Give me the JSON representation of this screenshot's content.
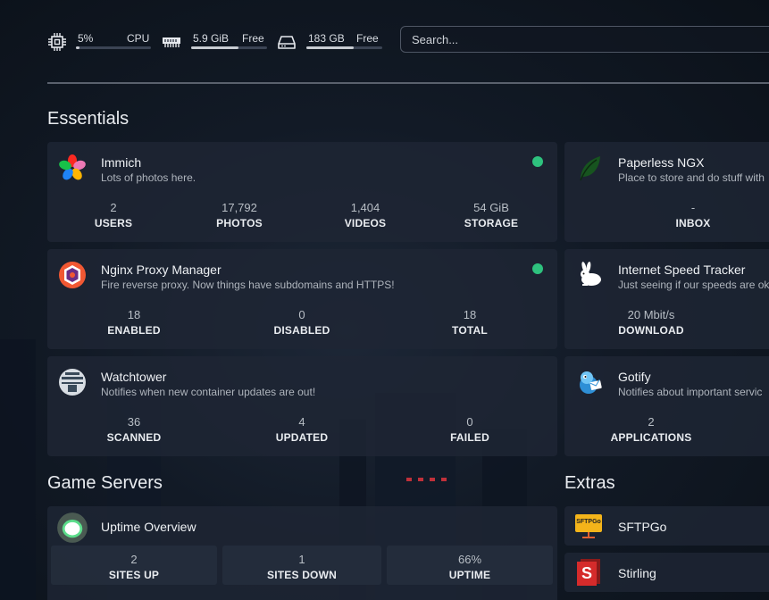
{
  "resources": {
    "cpu": {
      "value": "5%",
      "label": "CPU",
      "usage_fraction": 0.05
    },
    "memory": {
      "value": "5.9 GiB",
      "label": "Free",
      "usage_fraction": 0.62
    },
    "disk": {
      "value": "183 GB",
      "label": "Free",
      "usage_fraction": 0.62
    }
  },
  "search": {
    "placeholder": "Search..."
  },
  "sections": {
    "essentials": "Essentials",
    "game_servers": "Game Servers",
    "extras": "Extras"
  },
  "status_color": "#2ec27e",
  "cards": {
    "immich": {
      "title": "Immich",
      "desc": "Lots of photos here.",
      "icon": "immich-icon",
      "status": "online",
      "stats": [
        {
          "value": "2",
          "label": "USERS"
        },
        {
          "value": "17,792",
          "label": "PHOTOS"
        },
        {
          "value": "1,404",
          "label": "VIDEOS"
        },
        {
          "value": "54 GiB",
          "label": "STORAGE"
        }
      ]
    },
    "paperless": {
      "title": "Paperless NGX",
      "desc": "Place to store and do stuff with",
      "icon": "leaf-icon",
      "stats": [
        {
          "value": "-",
          "label": "INBOX"
        }
      ]
    },
    "nginx": {
      "title": "Nginx Proxy Manager",
      "desc": "Fire reverse proxy. Now things have subdomains and HTTPS!",
      "icon": "nginx-proxy-manager-icon",
      "status": "online",
      "stats": [
        {
          "value": "18",
          "label": "ENABLED"
        },
        {
          "value": "0",
          "label": "DISABLED"
        },
        {
          "value": "18",
          "label": "TOTAL"
        }
      ]
    },
    "speed": {
      "title": "Internet Speed Tracker",
      "desc": "Just seeing if our speeds are ok",
      "icon": "rabbit-icon",
      "stats": [
        {
          "value": "20 Mbit/s",
          "label": "DOWNLOAD"
        }
      ]
    },
    "watchtower": {
      "title": "Watchtower",
      "desc": "Notifies when new container updates are out!",
      "icon": "watchtower-icon",
      "stats": [
        {
          "value": "36",
          "label": "SCANNED"
        },
        {
          "value": "4",
          "label": "UPDATED"
        },
        {
          "value": "0",
          "label": "FAILED"
        }
      ]
    },
    "gotify": {
      "title": "Gotify",
      "desc": "Notifies about important servic",
      "icon": "gotify-icon",
      "stats": [
        {
          "value": "2",
          "label": "APPLICATIONS"
        }
      ]
    },
    "uptime": {
      "title": "Uptime Overview",
      "icon": "uptime-kuma-icon",
      "stats": [
        {
          "value": "2",
          "label": "SITES UP"
        },
        {
          "value": "1",
          "label": "SITES DOWN"
        },
        {
          "value": "66%",
          "label": "UPTIME"
        }
      ]
    },
    "sftpgo": {
      "title": "SFTPGo",
      "icon": "sftpgo-icon",
      "icon_text": "SFTPGo"
    },
    "stirling": {
      "title": "Stirling",
      "icon": "stirling-pdf-icon",
      "icon_text": "S"
    }
  }
}
